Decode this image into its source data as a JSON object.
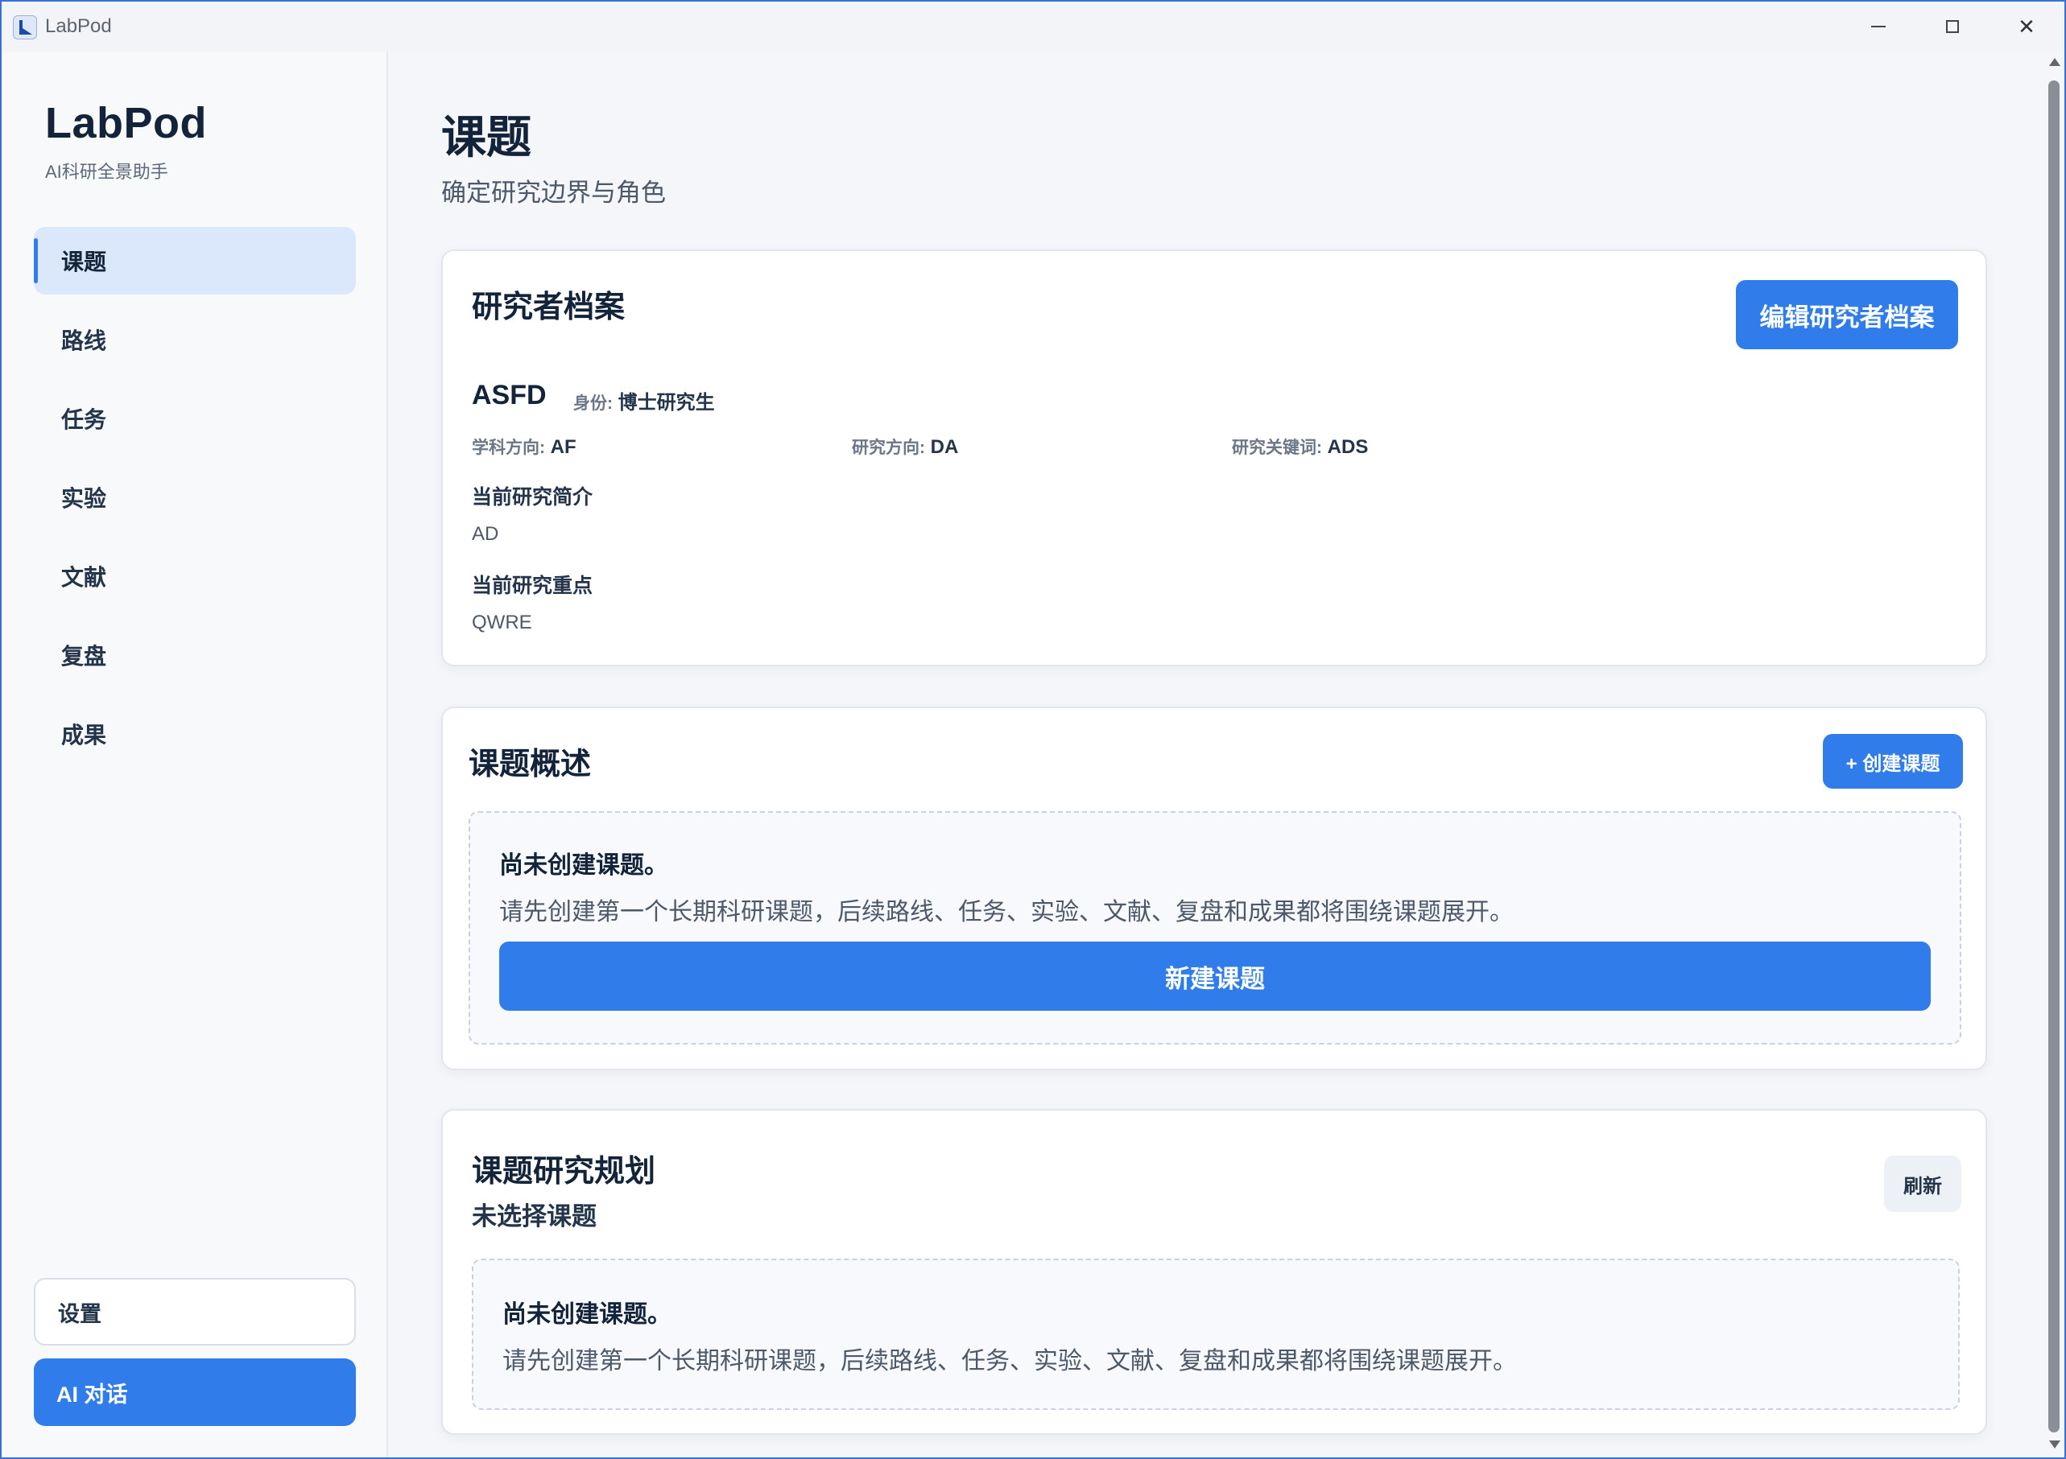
{
  "window": {
    "title": "LabPod"
  },
  "sidebar": {
    "brand": "LabPod",
    "brand_sub": "AI科研全景助手",
    "items": [
      {
        "label": "课题",
        "active": true
      },
      {
        "label": "路线"
      },
      {
        "label": "任务"
      },
      {
        "label": "实验"
      },
      {
        "label": "文献"
      },
      {
        "label": "复盘"
      },
      {
        "label": "成果"
      }
    ],
    "settings_label": "设置",
    "ai_label": "AI 对话"
  },
  "page": {
    "title": "课题",
    "subtitle": "确定研究边界与角色"
  },
  "profile_card": {
    "title": "研究者档案",
    "edit_label": "编辑研究者档案",
    "name": "ASFD",
    "role_label": "身份:",
    "role_value": "博士研究生",
    "discipline_label": "学科方向:",
    "discipline_value": "AF",
    "direction_label": "研究方向:",
    "direction_value": "DA",
    "keywords_label": "研究关键词:",
    "keywords_value": "ADS",
    "intro_heading": "当前研究简介",
    "intro_value": "AD",
    "focus_heading": "当前研究重点",
    "focus_value": "QWRE"
  },
  "overview_card": {
    "title": "课题概述",
    "create_label": "+ 创建课题",
    "empty_title": "尚未创建课题。",
    "empty_desc": "请先创建第一个长期科研课题，后续路线、任务、实验、文献、复盘和成果都将围绕课题展开。",
    "new_label": "新建课题"
  },
  "plan_card": {
    "title": "课题研究规划",
    "subtitle": "未选择课题",
    "refresh_label": "刷新",
    "empty_title": "尚未创建课题。",
    "empty_desc": "请先创建第一个长期科研课题，后续路线、任务、实验、文献、复盘和成果都将围绕课题展开。"
  },
  "colors": {
    "accent": "#2f7cea",
    "active_bg": "#dbe8fc"
  }
}
